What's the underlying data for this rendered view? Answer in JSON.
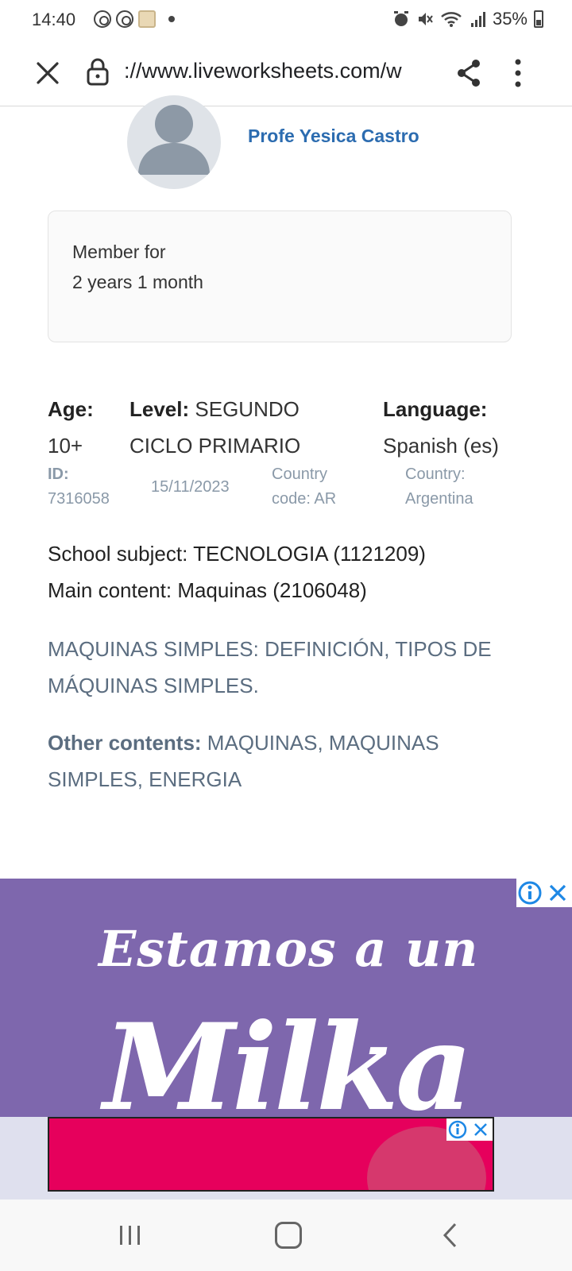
{
  "status_bar": {
    "time": "14:40",
    "battery": "35%"
  },
  "browser": {
    "url": "://www.liveworksheets.com/w"
  },
  "author": {
    "name": "Profe Yesica Castro"
  },
  "member": {
    "label": "Member for",
    "duration": "2 years 1 month"
  },
  "info": {
    "age_label": "Age:",
    "age_value": "10+",
    "level_label": "Level:",
    "level_value_1": "SEGUNDO",
    "level_value_2": "CICLO PRIMARIO",
    "language_label": "Language:",
    "language_value": "Spanish (es)",
    "id_label": "ID:",
    "id_value": "7316058",
    "date": "15/11/2023",
    "country_code_1": "Country",
    "country_code_2": "code: AR",
    "country_1": "Country:",
    "country_2": "Argentina"
  },
  "subject": {
    "school_subject": "School subject: TECNOLOGIA (1121209)",
    "main_content": "Main content: Maquinas (2106048)"
  },
  "description": "MAQUINAS SIMPLES: DEFINICIÓN, TIPOS DE MÁQUINAS SIMPLES.",
  "other_contents": {
    "label": "Other contents:",
    "value": " MAQUINAS, MAQUINAS SIMPLES, ENERGIA"
  },
  "ad": {
    "headline": "Estamos a un",
    "brand": "Milka",
    "bg_color": "#7e67ad",
    "secondary_bg_color": "#e6005c"
  },
  "colors": {
    "author_link": "#2c6cb0",
    "muted": "#8a99a8",
    "description": "#5b6d80"
  }
}
